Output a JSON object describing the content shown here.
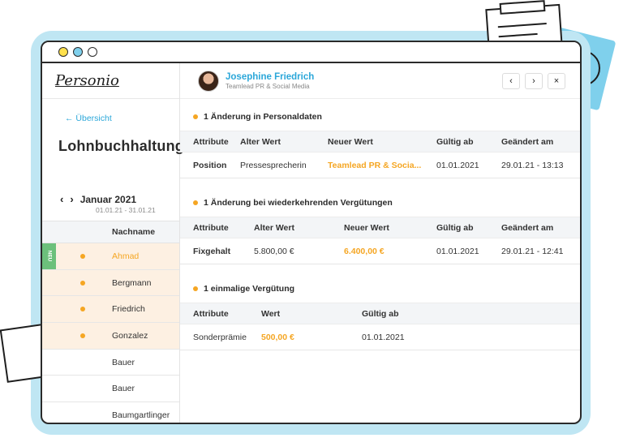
{
  "app": {
    "logo": "Personio"
  },
  "sidebar": {
    "back_label": "← Übersicht",
    "title": "Lohnbuchhaltung",
    "month": {
      "prev": "‹",
      "next": "›",
      "label": "Januar 2021",
      "range": "01.01.21 - 31.01.21"
    },
    "column_header": "Nachname",
    "new_badge": "NEU",
    "employees": [
      {
        "name": "Ahmad",
        "changed": true,
        "active": true,
        "new": true
      },
      {
        "name": "Bergmann",
        "changed": true
      },
      {
        "name": "Friedrich",
        "changed": true
      },
      {
        "name": "Gonzalez",
        "changed": true
      },
      {
        "name": "Bauer",
        "changed": false
      },
      {
        "name": "Bauer",
        "changed": false
      },
      {
        "name": "Baumgartlinger",
        "changed": false
      }
    ]
  },
  "header": {
    "name": "Josephine Friedrich",
    "role": "Teamlead PR & Social Media",
    "prev": "‹",
    "next": "›",
    "close": "×"
  },
  "sections": [
    {
      "title": "1 Änderung in Personaldaten",
      "columns": [
        "Attribute",
        "Alter Wert",
        "Neuer Wert",
        "Gültig ab",
        "Geändert am"
      ],
      "row": [
        "Position",
        "Pressesprecherin",
        "Teamlead PR & Socia...",
        "01.01.2021",
        "29.01.21 - 13:13"
      ]
    },
    {
      "title": "1 Änderung bei wiederkehrenden Vergütungen",
      "columns": [
        "Attribute",
        "Alter Wert",
        "Neuer Wert",
        "Gültig ab",
        "Geändert am"
      ],
      "row": [
        "Fixgehalt",
        "5.800,00 €",
        "6.400,00 €",
        "01.01.2021",
        "29.01.21 - 12:41"
      ]
    },
    {
      "title": "1 einmalige Vergütung",
      "columns": [
        "Attribute",
        "Wert",
        "Gültig ab"
      ],
      "row": [
        "Sonderprämie",
        "500,00 €",
        "01.01.2021"
      ]
    }
  ],
  "colors": {
    "accent_blue": "#2ba7d9",
    "accent_orange": "#f5a623",
    "new_green": "#6cc07b",
    "changed_row": "#fdf0e2"
  }
}
